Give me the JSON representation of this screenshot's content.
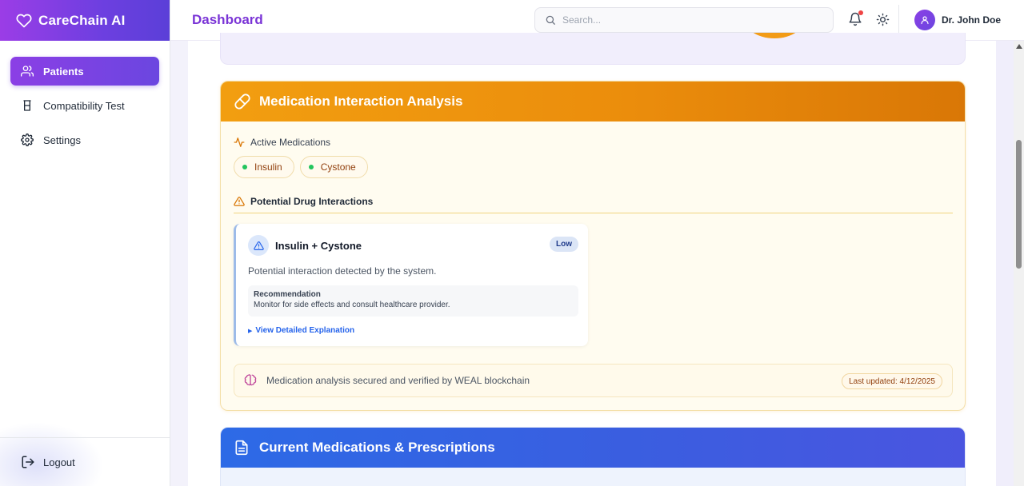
{
  "app": {
    "name": "CareChain AI",
    "logo_icon": "heart-icon"
  },
  "sidebar": {
    "items": [
      {
        "label": "Patients",
        "icon": "users-icon",
        "active": true
      },
      {
        "label": "Compatibility Test",
        "icon": "beaker-icon",
        "active": false
      },
      {
        "label": "Settings",
        "icon": "gear-icon",
        "active": false
      }
    ],
    "logout_label": "Logout"
  },
  "header": {
    "title": "Dashboard",
    "search_placeholder": "Search...",
    "user_name": "Dr. John Doe"
  },
  "medication_analysis": {
    "title": "Medication Interaction Analysis",
    "active_label": "Active Medications",
    "medications": [
      "Insulin",
      "Cystone"
    ],
    "interactions_label": "Potential Drug Interactions",
    "interaction": {
      "title": "Insulin + Cystone",
      "severity": "Low",
      "description": "Potential interaction detected by the system.",
      "recommendation_title": "Recommendation",
      "recommendation_text": "Monitor for side effects and consult healthcare provider.",
      "details_link": "View Detailed Explanation"
    },
    "footer_text": "Medication analysis secured and verified by WEAL blockchain",
    "last_updated": "Last updated: 4/12/2025"
  },
  "prescriptions": {
    "title": "Current Medications & Prescriptions"
  },
  "colors": {
    "brand": "#7a34d6",
    "accent_orange": "#f29e10",
    "accent_blue": "#2d6ae6",
    "status_green": "#22c55e",
    "notification_red": "#ef4444"
  }
}
